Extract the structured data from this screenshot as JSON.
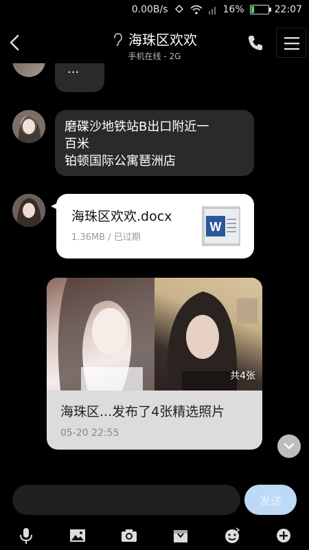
{
  "status_bar": {
    "network_speed": "0.00B/s",
    "battery_percent": "16%",
    "time": "22:07",
    "battery_level": 0.16
  },
  "header": {
    "title": "海珠区欢欢",
    "subtitle": "手机在线 - 2G",
    "icons": [
      "back-arrow-icon",
      "ear-icon",
      "phone-icon",
      "menu-icon"
    ]
  },
  "messages": {
    "partial_top": "...",
    "address": {
      "line1": "磨碟沙地铁站B出口附近一",
      "line2": "百米",
      "line3": "铂顿国际公寓琶洲店"
    },
    "file": {
      "name": "海珠区欢欢.docx",
      "meta": "1.36MB / 已过期",
      "icon": "word-doc-icon",
      "icon_letter": "W"
    },
    "photo_post": {
      "count_label": "共4张",
      "caption": "海珠区...发布了4张精选照片",
      "time": "05-20 22:55"
    }
  },
  "input": {
    "placeholder": "",
    "send_label": "发送"
  },
  "toolbar": {
    "icons": [
      "microphone-icon",
      "image-icon",
      "camera-icon",
      "gift-box-icon",
      "emoji-icon",
      "plus-icon"
    ]
  },
  "colors": {
    "background": "#000000",
    "bubble": "#2a2a2c",
    "send_button": "#bcd9f5",
    "word_blue": "#2b579a"
  }
}
